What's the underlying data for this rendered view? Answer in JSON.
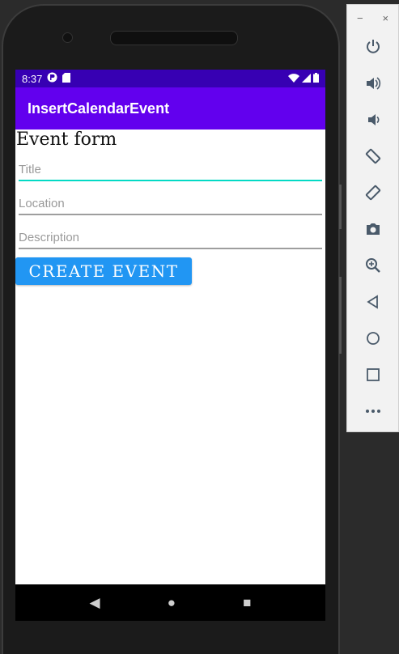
{
  "status_bar": {
    "time": "8:37",
    "left_icons": [
      "app-notification-icon",
      "sd-card-icon"
    ],
    "right_icons": [
      "wifi-icon",
      "signal-icon",
      "battery-icon"
    ]
  },
  "app_bar": {
    "title": "InsertCalendarEvent"
  },
  "form": {
    "heading": "Event form",
    "title_placeholder": "Title",
    "location_placeholder": "Location",
    "description_placeholder": "Description",
    "create_button_label": "CREATE EVENT"
  },
  "nav_bar": {
    "back_glyph": "◀",
    "home_glyph": "●",
    "recents_glyph": "■"
  },
  "emulator_toolbar": {
    "minimize_glyph": "−",
    "close_glyph": "×",
    "buttons": [
      {
        "name": "power-icon",
        "glyph": "⏻"
      },
      {
        "name": "volume-up-icon",
        "glyph": "🔊"
      },
      {
        "name": "volume-down-icon",
        "glyph": "🔉"
      },
      {
        "name": "rotate-left-icon",
        "glyph": "⟲"
      },
      {
        "name": "rotate-right-icon",
        "glyph": "⟳"
      },
      {
        "name": "camera-icon",
        "glyph": "📷"
      },
      {
        "name": "zoom-icon",
        "glyph": "⊕"
      },
      {
        "name": "back-icon",
        "glyph": "◁"
      },
      {
        "name": "home-icon",
        "glyph": "○"
      },
      {
        "name": "overview-icon",
        "glyph": "□"
      },
      {
        "name": "more-icon",
        "glyph": "•••"
      }
    ]
  },
  "colors": {
    "status_bar": "#3700b3",
    "app_bar": "#6200ee",
    "button": "#2196f3",
    "focus_underline": "#03dac5"
  }
}
